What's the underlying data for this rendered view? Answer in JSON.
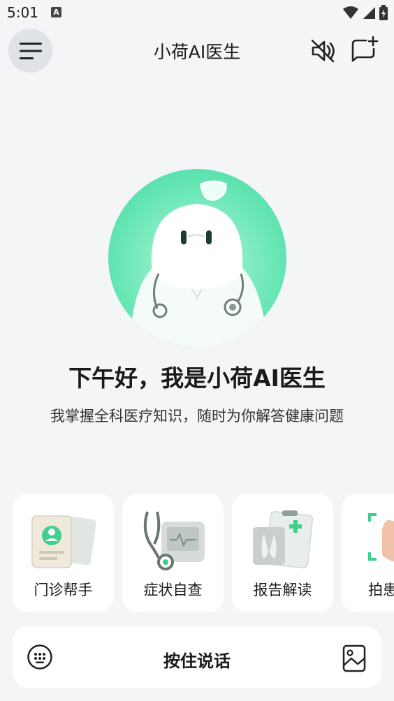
{
  "status_bar": {
    "time": "5:01",
    "notification_badge": "A",
    "icons": [
      "wifi-icon",
      "signal-icon",
      "battery-icon"
    ]
  },
  "header": {
    "title": "小荷AI医生",
    "icons": [
      "menu-icon",
      "mute-icon",
      "new-chat-icon"
    ]
  },
  "hero": {
    "greeting": "下午好，我是小荷AI医生",
    "subtitle": "我掌握全科医疗知识，随时为你解答健康问题"
  },
  "features": [
    {
      "label": "门诊帮手",
      "icon": "clinic-helper-icon"
    },
    {
      "label": "症状自查",
      "icon": "symptom-check-icon"
    },
    {
      "label": "报告解读",
      "icon": "report-reading-icon"
    },
    {
      "label": "拍患",
      "icon": "photo-scan-icon"
    }
  ],
  "input_bar": {
    "talk_label": "按住说话",
    "icons": [
      "keyboard-icon",
      "image-icon"
    ]
  },
  "colors": {
    "background": "#f3f5f7",
    "accent_green": "#3fd89e",
    "card": "#ffffff"
  }
}
